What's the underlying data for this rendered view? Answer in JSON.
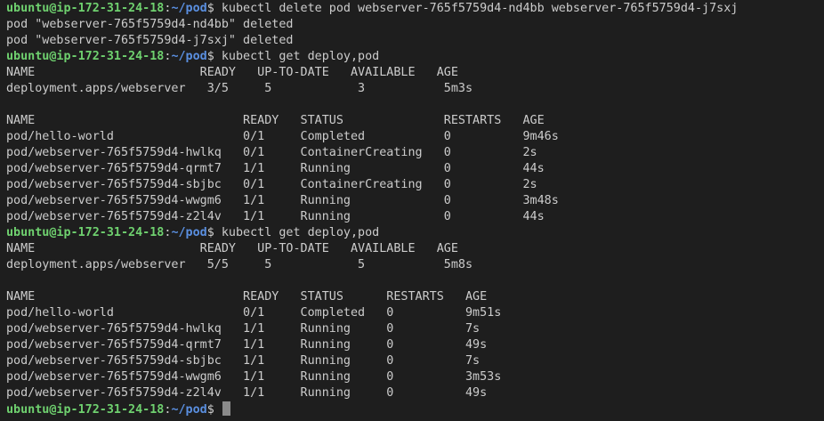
{
  "prompt": {
    "user_host": "ubuntu@ip-172-31-24-18",
    "sep": ":",
    "path": "~/pod",
    "sign": "$ "
  },
  "colors": {
    "background": "#1e1e1e",
    "text": "#cccccc",
    "user_host": "#6fd16f",
    "path": "#5a8fe0",
    "cursor": "#8a8a8a"
  },
  "lines": [
    {
      "type": "prompt",
      "command": "kubectl delete pod webserver-765f5759d4-nd4bb webserver-765f5759d4-j7sxj"
    },
    {
      "type": "output",
      "text": "pod \"webserver-765f5759d4-nd4bb\" deleted"
    },
    {
      "type": "output",
      "text": "pod \"webserver-765f5759d4-j7sxj\" deleted"
    },
    {
      "type": "prompt",
      "command": "kubectl get deploy,pod"
    },
    {
      "type": "output",
      "text": "NAME                       READY   UP-TO-DATE   AVAILABLE   AGE"
    },
    {
      "type": "output",
      "text": "deployment.apps/webserver   3/5     5            3           5m3s"
    },
    {
      "type": "output",
      "text": ""
    },
    {
      "type": "output",
      "text": "NAME                             READY   STATUS              RESTARTS   AGE"
    },
    {
      "type": "output",
      "text": "pod/hello-world                  0/1     Completed           0          9m46s"
    },
    {
      "type": "output",
      "text": "pod/webserver-765f5759d4-hwlkq   0/1     ContainerCreating   0          2s"
    },
    {
      "type": "output",
      "text": "pod/webserver-765f5759d4-qrmt7   1/1     Running             0          44s"
    },
    {
      "type": "output",
      "text": "pod/webserver-765f5759d4-sbjbc   0/1     ContainerCreating   0          2s"
    },
    {
      "type": "output",
      "text": "pod/webserver-765f5759d4-wwgm6   1/1     Running             0          3m48s"
    },
    {
      "type": "output",
      "text": "pod/webserver-765f5759d4-z2l4v   1/1     Running             0          44s"
    },
    {
      "type": "prompt",
      "command": "kubectl get deploy,pod"
    },
    {
      "type": "output",
      "text": "NAME                       READY   UP-TO-DATE   AVAILABLE   AGE"
    },
    {
      "type": "output",
      "text": "deployment.apps/webserver   5/5     5            5           5m8s"
    },
    {
      "type": "output",
      "text": ""
    },
    {
      "type": "output",
      "text": "NAME                             READY   STATUS      RESTARTS   AGE"
    },
    {
      "type": "output",
      "text": "pod/hello-world                  0/1     Completed   0          9m51s"
    },
    {
      "type": "output",
      "text": "pod/webserver-765f5759d4-hwlkq   1/1     Running     0          7s"
    },
    {
      "type": "output",
      "text": "pod/webserver-765f5759d4-qrmt7   1/1     Running     0          49s"
    },
    {
      "type": "output",
      "text": "pod/webserver-765f5759d4-sbjbc   1/1     Running     0          7s"
    },
    {
      "type": "output",
      "text": "pod/webserver-765f5759d4-wwgm6   1/1     Running     0          3m53s"
    },
    {
      "type": "output",
      "text": "pod/webserver-765f5759d4-z2l4v   1/1     Running     0          49s"
    },
    {
      "type": "prompt",
      "command": "",
      "cursor": true
    }
  ]
}
